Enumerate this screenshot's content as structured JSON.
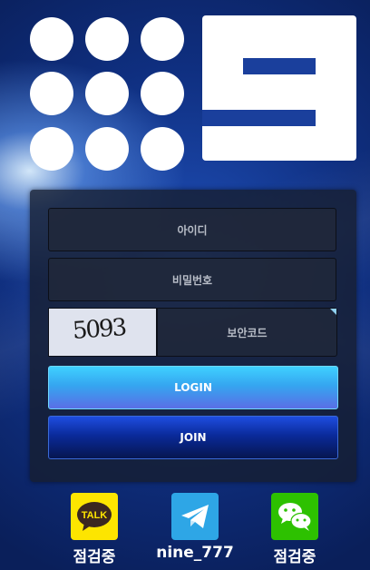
{
  "brand": {
    "name": "9 logo",
    "accent_color": "#1a3f9c"
  },
  "login_form": {
    "id_placeholder": "아이디",
    "password_placeholder": "비밀번호",
    "captcha_image_text": "5093",
    "captcha_placeholder": "보안코드",
    "login_label": "LOGIN",
    "join_label": "JOIN"
  },
  "contacts": [
    {
      "icon": "kakaotalk-icon",
      "icon_text": "TALK",
      "label": "점검중",
      "color": "#fde500"
    },
    {
      "icon": "telegram-icon",
      "label": "nine_777",
      "color": "#2ea6e6"
    },
    {
      "icon": "wechat-icon",
      "label": "점검중",
      "color": "#2dc100"
    }
  ]
}
